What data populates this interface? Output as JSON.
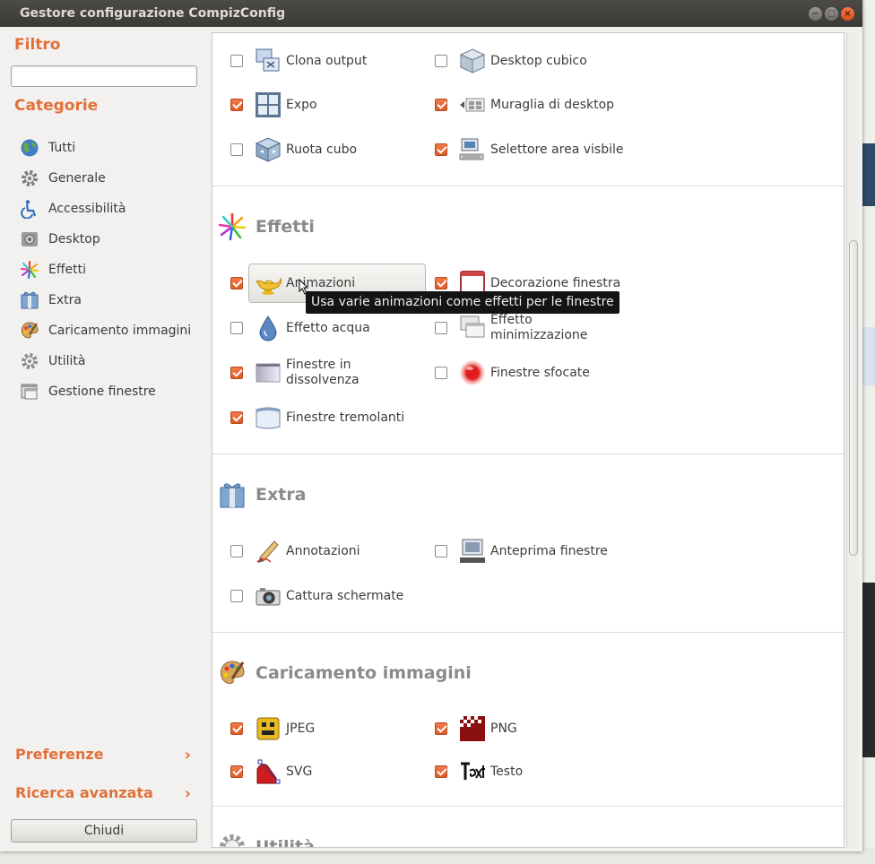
{
  "window": {
    "title": "Gestore configurazione CompizConfig"
  },
  "sidebar": {
    "filter_label": "Filtro",
    "filter_value": "",
    "categories_label": "Categorie",
    "categories": [
      {
        "label": "Tutti",
        "icon": "globe-icon"
      },
      {
        "label": "Generale",
        "icon": "gear-icon"
      },
      {
        "label": "Accessibilità",
        "icon": "accessibility-icon"
      },
      {
        "label": "Desktop",
        "icon": "desktop-icon"
      },
      {
        "label": "Effetti",
        "icon": "fireworks-icon"
      },
      {
        "label": "Extra",
        "icon": "extra-icon"
      },
      {
        "label": "Caricamento immagini",
        "icon": "palette-icon"
      },
      {
        "label": "Utilità",
        "icon": "utility-gear-icon"
      },
      {
        "label": "Gestione finestre",
        "icon": "window-management-icon"
      }
    ],
    "preferences_label": "Preferenze",
    "advanced_search_label": "Ricerca avanzata",
    "close_label": "Chiudi"
  },
  "main": {
    "desktop_plugins": [
      {
        "name": "Clona output",
        "enabled": false
      },
      {
        "name": "Desktop cubico",
        "enabled": false
      },
      {
        "name": "Expo",
        "enabled": true
      },
      {
        "name": "Muraglia di desktop",
        "enabled": true
      },
      {
        "name": "Ruota cubo",
        "enabled": false
      },
      {
        "name": "Selettore area visbile",
        "enabled": true
      }
    ],
    "effects": {
      "title": "Effetti",
      "plugins": [
        {
          "name": "Animazioni",
          "enabled": true
        },
        {
          "name": "Decorazione finestra",
          "enabled": true
        },
        {
          "name": "Effetto acqua",
          "enabled": false
        },
        {
          "name": "Effetto minimizzazione",
          "enabled": false
        },
        {
          "name": "Finestre in dissolvenza",
          "enabled": true
        },
        {
          "name": "Finestre sfocate",
          "enabled": false
        },
        {
          "name": "Finestre tremolanti",
          "enabled": true
        }
      ]
    },
    "extra": {
      "title": "Extra",
      "plugins": [
        {
          "name": "Annotazioni",
          "enabled": false
        },
        {
          "name": "Anteprima finestre",
          "enabled": false
        },
        {
          "name": "Cattura schermate",
          "enabled": false
        }
      ]
    },
    "image_loading": {
      "title": "Caricamento immagini",
      "plugins": [
        {
          "name": "JPEG",
          "enabled": true
        },
        {
          "name": "PNG",
          "enabled": true
        },
        {
          "name": "SVG",
          "enabled": true
        },
        {
          "name": "Testo",
          "enabled": true
        }
      ]
    },
    "utility": {
      "title": "Utilità"
    }
  },
  "tooltip": {
    "text": "Usa varie animazioni come effetti per le finestre"
  },
  "colors": {
    "accent": "#e2703a",
    "checkbox_on": "#e05b25",
    "titlebar": "#3c3b37"
  }
}
